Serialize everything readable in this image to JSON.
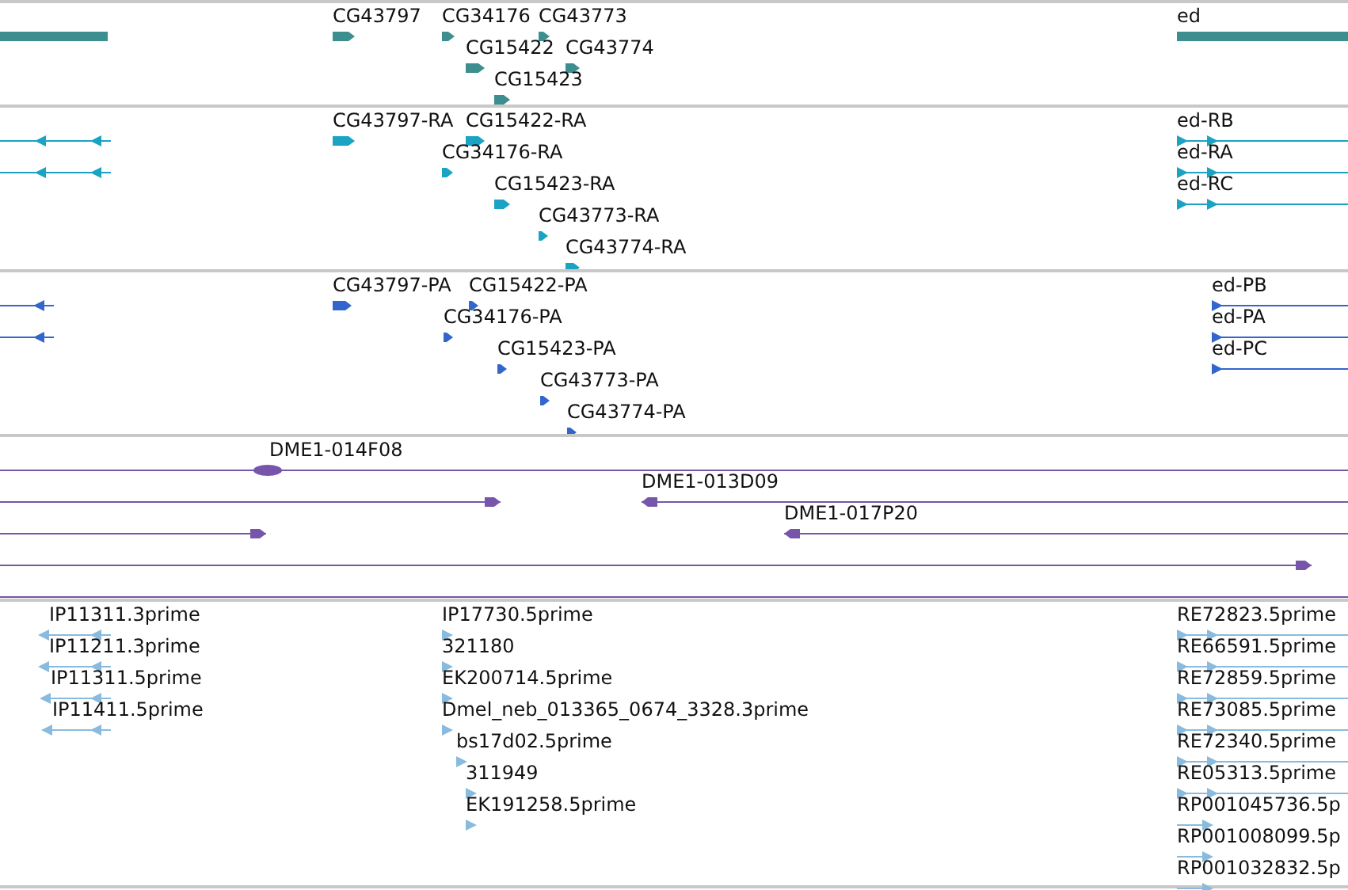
{
  "tracks": [
    {
      "kind": "gene",
      "features": [
        {
          "label": "CG43797"
        },
        {
          "label": "CG34176"
        },
        {
          "label": "CG43773"
        },
        {
          "label": "CG15422"
        },
        {
          "label": "CG43774"
        },
        {
          "label": "CG15423"
        },
        {
          "label": "ed"
        }
      ]
    },
    {
      "kind": "mrna",
      "features": [
        {
          "label": "CG43797-RA"
        },
        {
          "label": "CG15422-RA"
        },
        {
          "label": "CG34176-RA"
        },
        {
          "label": "CG15423-RA"
        },
        {
          "label": "CG43773-RA"
        },
        {
          "label": "CG43774-RA"
        },
        {
          "label": "ed-RB"
        },
        {
          "label": "ed-RA"
        },
        {
          "label": "ed-RC"
        }
      ]
    },
    {
      "kind": "protein",
      "features": [
        {
          "label": "CG43797-PA"
        },
        {
          "label": "CG15422-PA"
        },
        {
          "label": "CG34176-PA"
        },
        {
          "label": "CG15423-PA"
        },
        {
          "label": "CG43773-PA"
        },
        {
          "label": "CG43774-PA"
        },
        {
          "label": "ed-PB"
        },
        {
          "label": "ed-PA"
        },
        {
          "label": "ed-PC"
        }
      ]
    },
    {
      "kind": "clone",
      "features": [
        {
          "label": "DME1-014F08"
        },
        {
          "label": "DME1-013D09"
        },
        {
          "label": "DME1-017P20"
        }
      ]
    },
    {
      "kind": "est",
      "features": [
        {
          "label": "IP11311.3prime"
        },
        {
          "label": "IP11211.3prime"
        },
        {
          "label": "IP11311.5prime"
        },
        {
          "label": "IP11411.5prime"
        },
        {
          "label": "IP17730.5prime"
        },
        {
          "label": "321180"
        },
        {
          "label": "EK200714.5prime"
        },
        {
          "label": "Dmel_neb_013365_0674_3328.3prime"
        },
        {
          "label": "bs17d02.5prime"
        },
        {
          "label": "311949"
        },
        {
          "label": "EK191258.5prime"
        },
        {
          "label": "RE72823.5prime"
        },
        {
          "label": "RE66591.5prime"
        },
        {
          "label": "RE72859.5prime"
        },
        {
          "label": "RE73085.5prime"
        },
        {
          "label": "RE72340.5prime"
        },
        {
          "label": "RE05313.5prime"
        },
        {
          "label": "RP001045736.5p"
        },
        {
          "label": "RP001008099.5p"
        },
        {
          "label": "RP001032832.5p"
        }
      ]
    }
  ]
}
